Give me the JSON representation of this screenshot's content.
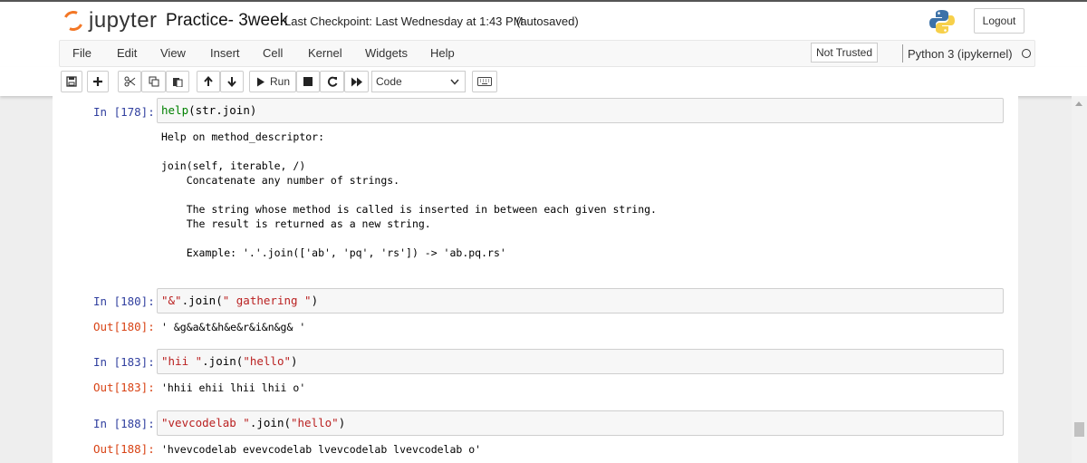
{
  "header": {
    "brand": "jupyter",
    "notebook_name": "Practice- 3week",
    "checkpoint": "Last Checkpoint: Last Wednesday at 1:43 PM",
    "autosave": "(autosaved)",
    "logout_label": "Logout"
  },
  "menu": {
    "items": [
      "File",
      "Edit",
      "View",
      "Insert",
      "Cell",
      "Kernel",
      "Widgets",
      "Help"
    ],
    "trust": "Not Trusted",
    "kernel": "Python 3 (ipykernel)"
  },
  "toolbar": {
    "run_label": "Run",
    "cell_type": "Code"
  },
  "cells": [
    {
      "in_prompt": "In [178]:",
      "code": "help(str.join)",
      "output": "Help on method_descriptor:\n\njoin(self, iterable, /)\n    Concatenate any number of strings.\n\n    The string whose method is called is inserted in between each given string.\n    The result is returned as a new string.\n\n    Example: '.'.join(['ab', 'pq', 'rs']) -> 'ab.pq.rs'"
    },
    {
      "in_prompt": "In [180]:",
      "code_str1": "\"&\"",
      "code_mid": ".join(",
      "code_str2": "\" gathering \"",
      "code_end": ")",
      "out_prompt": "Out[180]:",
      "output": "' &g&a&t&h&e&r&i&n&g& '"
    },
    {
      "in_prompt": "In [183]:",
      "code_str1": "\"hii \"",
      "code_mid": ".join(",
      "code_str2": "\"hello\"",
      "code_end": ")",
      "out_prompt": "Out[183]:",
      "output": "'hhii ehii lhii lhii o'"
    },
    {
      "in_prompt": "In [188]:",
      "code_str1": "\"vevcodelab \"",
      "code_mid": ".join(",
      "code_str2": "\"hello\"",
      "code_end": ")",
      "out_prompt": "Out[188]:",
      "output": "'hvevcodelab evevcodelab lvevcodelab lvevcodelab o'"
    }
  ],
  "colors": {
    "in_prompt": "#303f9f",
    "out_prompt": "#d84315",
    "string": "#ba2121",
    "builtin": "#008000",
    "jupyter_orange": "#f37726"
  },
  "icons": [
    "save-icon",
    "plus-icon",
    "scissors-icon",
    "copy-icon",
    "paste-icon",
    "arrow-up-icon",
    "arrow-down-icon",
    "play-icon",
    "stop-icon",
    "restart-icon",
    "fast-forward-icon",
    "keyboard-icon",
    "python-logo-icon",
    "kernel-idle-icon"
  ]
}
